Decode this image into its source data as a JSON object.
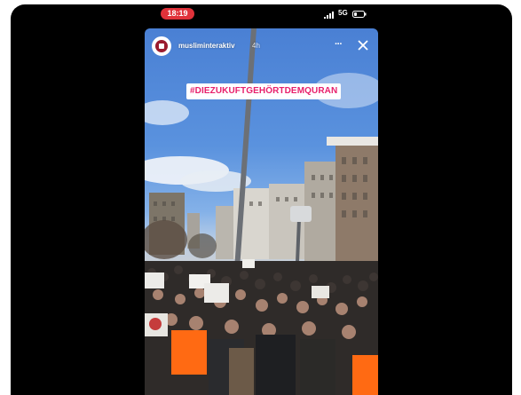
{
  "status_bar": {
    "time": "18:19",
    "network": "5G",
    "signal_icon": "signal-bars-icon",
    "battery_icon": "battery-icon"
  },
  "story": {
    "username": "musliminteraktiv",
    "timestamp": "4h",
    "hashtag": "#DIEZUKUFTGEHÖRTDEMQURAN",
    "more_icon": "more-icon",
    "close_icon": "close-icon"
  },
  "colors": {
    "time_pill": "#e0323a",
    "hashtag_text": "#e8206b",
    "hashtag_bg": "#ffffff",
    "sky": "#5a92de",
    "vest": "#ff6a13"
  }
}
